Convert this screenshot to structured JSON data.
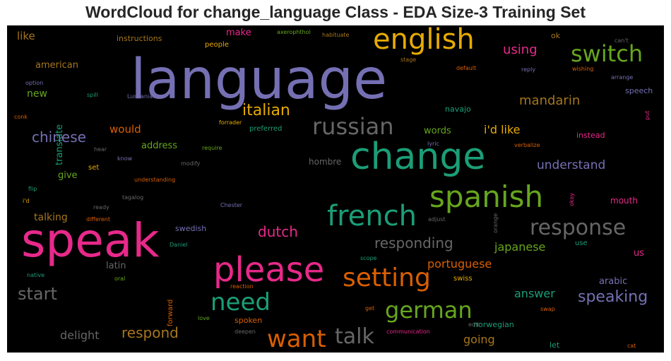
{
  "chart_data": {
    "type": "wordcloud",
    "title": "WordCloud for change_language Class - EDA Size-3 Training Set",
    "background": "#000000",
    "palette": [
      "#7570b3",
      "#1b9e77",
      "#e7298a",
      "#d95f02",
      "#e6ab02",
      "#66a61e",
      "#a6761d",
      "#666666"
    ],
    "words": [
      {
        "text": "language",
        "color": "#7570b3"
      },
      {
        "text": "speak",
        "color": "#e7298a"
      },
      {
        "text": "change",
        "color": "#1b9e77"
      },
      {
        "text": "english",
        "color": "#e6ab02"
      },
      {
        "text": "please",
        "color": "#e7298a"
      },
      {
        "text": "spanish",
        "color": "#66a61e"
      },
      {
        "text": "french",
        "color": "#1b9e77"
      },
      {
        "text": "switch",
        "color": "#66a61e"
      },
      {
        "text": "russian",
        "color": "#666666"
      },
      {
        "text": "setting",
        "color": "#d95f02"
      },
      {
        "text": "want",
        "color": "#d95f02"
      },
      {
        "text": "need",
        "color": "#1b9e77"
      },
      {
        "text": "german",
        "color": "#66a61e"
      },
      {
        "text": "response",
        "color": "#666666"
      },
      {
        "text": "talk",
        "color": "#666666"
      },
      {
        "text": "italian",
        "color": "#e6ab02"
      },
      {
        "text": "start",
        "color": "#666666"
      },
      {
        "text": "chinese",
        "color": "#7570b3"
      },
      {
        "text": "speaking",
        "color": "#7570b3"
      },
      {
        "text": "responding",
        "color": "#666666"
      },
      {
        "text": "respond",
        "color": "#a6761d"
      },
      {
        "text": "mandarin",
        "color": "#a6761d"
      },
      {
        "text": "dutch",
        "color": "#e7298a"
      },
      {
        "text": "using",
        "color": "#e7298a"
      },
      {
        "text": "understand",
        "color": "#7570b3"
      },
      {
        "text": "i'd like",
        "color": "#e6ab02"
      },
      {
        "text": "portuguese",
        "color": "#d95f02"
      },
      {
        "text": "japanese",
        "color": "#66a61e"
      },
      {
        "text": "delight",
        "color": "#666666"
      },
      {
        "text": "answer",
        "color": "#1b9e77"
      },
      {
        "text": "going",
        "color": "#a6761d"
      },
      {
        "text": "would",
        "color": "#d95f02"
      },
      {
        "text": "like",
        "color": "#a6761d"
      },
      {
        "text": "make",
        "color": "#e7298a"
      },
      {
        "text": "new",
        "color": "#66a61e"
      },
      {
        "text": "talking",
        "color": "#a6761d"
      },
      {
        "text": "words",
        "color": "#66a61e"
      },
      {
        "text": "address",
        "color": "#66a61e"
      },
      {
        "text": "give",
        "color": "#66a61e"
      },
      {
        "text": "latin",
        "color": "#666666"
      },
      {
        "text": "arabic",
        "color": "#7570b3"
      },
      {
        "text": "american",
        "color": "#a6761d"
      },
      {
        "text": "translate",
        "color": "#1b9e77"
      },
      {
        "text": "swedish",
        "color": "#7570b3"
      },
      {
        "text": "hombre",
        "color": "#666666"
      },
      {
        "text": "navajo",
        "color": "#1b9e77"
      },
      {
        "text": "norwegian",
        "color": "#1b9e77"
      },
      {
        "text": "instead",
        "color": "#e7298a"
      },
      {
        "text": "speech",
        "color": "#7570b3"
      },
      {
        "text": "mouth",
        "color": "#e7298a"
      },
      {
        "text": "us",
        "color": "#e7298a"
      },
      {
        "text": "let",
        "color": "#1b9e77"
      },
      {
        "text": "ok",
        "color": "#a6761d"
      },
      {
        "text": "instructions",
        "color": "#a6761d"
      },
      {
        "text": "spoken",
        "color": "#d95f02"
      },
      {
        "text": "people",
        "color": "#e6ab02"
      },
      {
        "text": "set",
        "color": "#e6ab02"
      },
      {
        "text": "preferred",
        "color": "#1b9e77"
      },
      {
        "text": "swiss",
        "color": "#e6ab02"
      },
      {
        "text": "forward",
        "color": "#d95f02"
      },
      {
        "text": "use",
        "color": "#1b9e77"
      },
      {
        "text": "axerophthol",
        "color": "#66a61e"
      },
      {
        "text": "habituate",
        "color": "#a6761d"
      },
      {
        "text": "stage",
        "color": "#a6761d"
      },
      {
        "text": "default",
        "color": "#d95f02"
      },
      {
        "text": "reply",
        "color": "#7570b3"
      },
      {
        "text": "wishing",
        "color": "#d95f02"
      },
      {
        "text": "can't",
        "color": "#666666"
      },
      {
        "text": "arrange",
        "color": "#7570b3"
      },
      {
        "text": "option",
        "color": "#7570b3"
      },
      {
        "text": "spill",
        "color": "#1b9e77"
      },
      {
        "text": "Lusitanian",
        "color": "#7570b3"
      },
      {
        "text": "conk",
        "color": "#d95f02"
      },
      {
        "text": "forrader",
        "color": "#e6ab02"
      },
      {
        "text": "lyric",
        "color": "#7570b3"
      },
      {
        "text": "verbalize",
        "color": "#d95f02"
      },
      {
        "text": "put",
        "color": "#e7298a"
      },
      {
        "text": "hear",
        "color": "#666666"
      },
      {
        "text": "know",
        "color": "#7570b3"
      },
      {
        "text": "require",
        "color": "#66a61e"
      },
      {
        "text": "modify",
        "color": "#666666"
      },
      {
        "text": "understanding",
        "color": "#d95f02"
      },
      {
        "text": "flip",
        "color": "#1b9e77"
      },
      {
        "text": "tagalog",
        "color": "#666666"
      },
      {
        "text": "Chester",
        "color": "#7570b3"
      },
      {
        "text": "okay",
        "color": "#e7298a"
      },
      {
        "text": "i'd",
        "color": "#e6ab02"
      },
      {
        "text": "ready",
        "color": "#666666"
      },
      {
        "text": "different",
        "color": "#d95f02"
      },
      {
        "text": "adjust",
        "color": "#666666"
      },
      {
        "text": "orange",
        "color": "#666666"
      },
      {
        "text": "Daniel",
        "color": "#1b9e77"
      },
      {
        "text": "native",
        "color": "#1b9e77"
      },
      {
        "text": "oral",
        "color": "#66a61e"
      },
      {
        "text": "scope",
        "color": "#1b9e77"
      },
      {
        "text": "reaction",
        "color": "#d95f02"
      },
      {
        "text": "get",
        "color": "#d95f02"
      },
      {
        "text": "swap",
        "color": "#d95f02"
      },
      {
        "text": "love",
        "color": "#66a61e"
      },
      {
        "text": "deepen",
        "color": "#666666"
      },
      {
        "text": "communication",
        "color": "#e7298a"
      },
      {
        "text": "edit",
        "color": "#666666"
      },
      {
        "text": "cat",
        "color": "#d95f02"
      }
    ]
  }
}
